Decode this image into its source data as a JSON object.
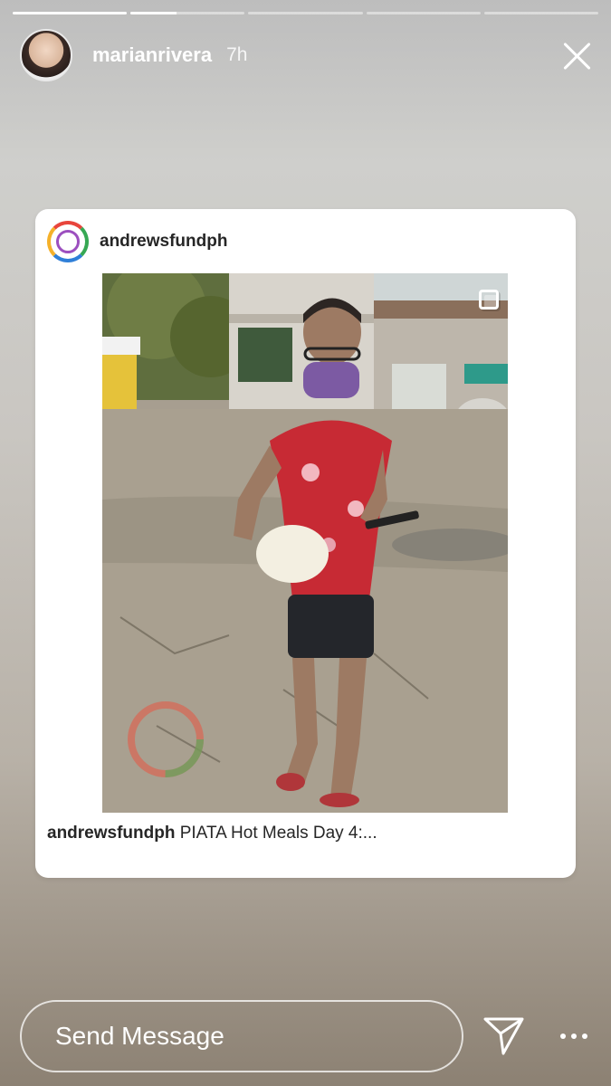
{
  "story": {
    "segments": [
      1,
      0.4,
      0,
      0,
      0
    ],
    "username": "marianrivera",
    "time": "7h"
  },
  "post": {
    "username": "andrewsfundph",
    "caption_user": "andrewsfundph",
    "caption_text": " PIATA Hot Meals Day 4:..."
  },
  "footer": {
    "message_placeholder": "Send Message"
  },
  "colors": {
    "accent_white": "#ffffff",
    "card_text": "#262626"
  }
}
